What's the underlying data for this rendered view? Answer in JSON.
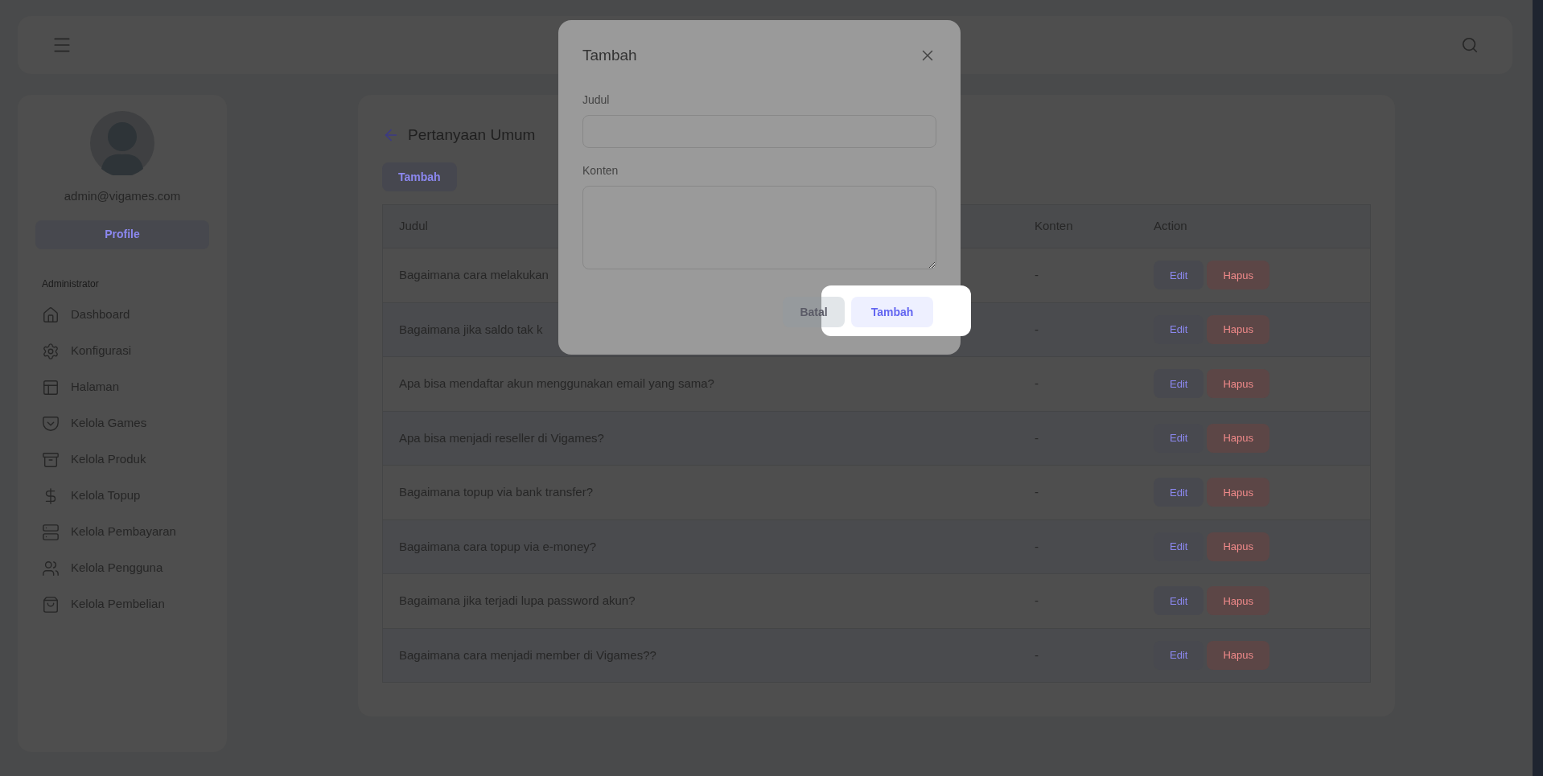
{
  "sidebar": {
    "email": "admin@vigames.com",
    "profile_button": "Profile",
    "section_label": "Administrator",
    "items": [
      {
        "label": "Dashboard"
      },
      {
        "label": "Konfigurasi"
      },
      {
        "label": "Halaman"
      },
      {
        "label": "Kelola Games"
      },
      {
        "label": "Kelola Produk"
      },
      {
        "label": "Kelola Topup"
      },
      {
        "label": "Kelola Pembayaran"
      },
      {
        "label": "Kelola Pengguna"
      },
      {
        "label": "Kelola Pembelian"
      }
    ]
  },
  "main": {
    "title": "Pertanyaan Umum",
    "add_button": "Tambah",
    "table": {
      "columns": [
        "Judul",
        "Konten",
        "Action"
      ],
      "rows": [
        {
          "judul": "Bagaimana cara melakukan",
          "konten": "-",
          "edit": "Edit",
          "hapus": "Hapus"
        },
        {
          "judul": "Bagaimana jika saldo tak k",
          "konten": "-",
          "edit": "Edit",
          "hapus": "Hapus"
        },
        {
          "judul": "Apa bisa mendaftar akun menggunakan email yang sama?",
          "konten": "-",
          "edit": "Edit",
          "hapus": "Hapus"
        },
        {
          "judul": "Apa bisa menjadi reseller di Vigames?",
          "konten": "-",
          "edit": "Edit",
          "hapus": "Hapus"
        },
        {
          "judul": "Bagaimana topup via bank transfer?",
          "konten": "-",
          "edit": "Edit",
          "hapus": "Hapus"
        },
        {
          "judul": "Bagaimana cara topup via e-money?",
          "konten": "-",
          "edit": "Edit",
          "hapus": "Hapus"
        },
        {
          "judul": "Bagaimana jika terjadi lupa password akun?",
          "konten": "-",
          "edit": "Edit",
          "hapus": "Hapus"
        },
        {
          "judul": "Bagaimana cara menjadi member di Vigames??",
          "konten": "-",
          "edit": "Edit",
          "hapus": "Hapus"
        }
      ]
    }
  },
  "modal": {
    "title": "Tambah",
    "fields": [
      {
        "label": "Judul",
        "kind": "input"
      },
      {
        "label": "Konten",
        "kind": "textarea"
      }
    ],
    "cancel_button": "Batal",
    "submit_button": "Tambah"
  }
}
